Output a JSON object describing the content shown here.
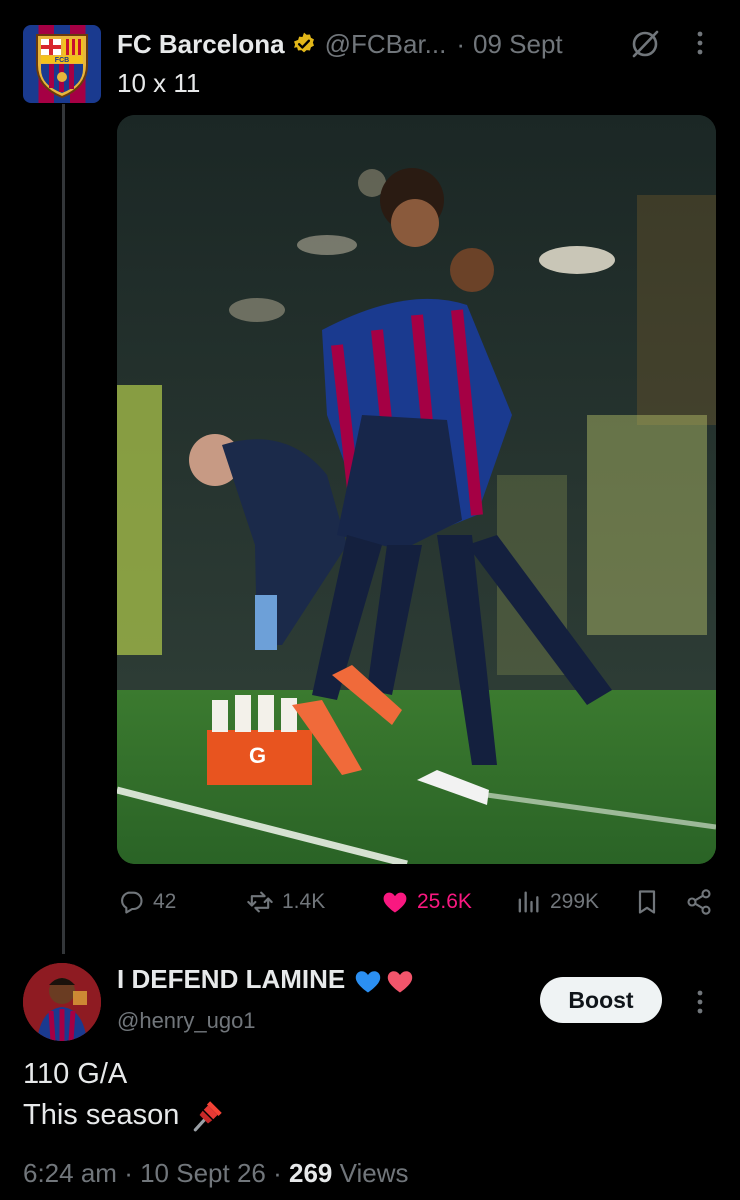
{
  "post": {
    "author_name": "FC Barcelona",
    "handle": "@FCBar...",
    "separator": "·",
    "date": "09 Sept",
    "text": "10 x 11",
    "avatar_text": "FCB",
    "image_text": "G",
    "actions": {
      "replies": "42",
      "reposts": "1.4K",
      "likes": "25.6K",
      "views": "299K"
    }
  },
  "reply": {
    "author_name": "I DEFEND LAMINE",
    "handle": "@henry_ugo1",
    "boost_label": "Boost",
    "text_line1": "110 G/A",
    "text_line2": "This season",
    "meta_time": "6:24 am",
    "meta_sep": "·",
    "meta_date": "10 Sept 26",
    "meta_sep2": "·",
    "views_count": "269",
    "views_label": "Views"
  },
  "colors": {
    "background": "#000000",
    "text_primary": "#e7e9ea",
    "text_secondary": "#71767b",
    "like_pink": "#f91880",
    "verified_gold": "#e2b719",
    "barca_blue": "#1a3a8f",
    "barca_red": "#a50044"
  },
  "icons": [
    "verified-badge-icon",
    "grok-icon",
    "more-icon",
    "reply-icon",
    "repost-icon",
    "heart-icon",
    "views-icon",
    "bookmark-icon",
    "share-icon",
    "blue-heart-emoji",
    "red-heart-emoji",
    "pushpin-emoji"
  ]
}
